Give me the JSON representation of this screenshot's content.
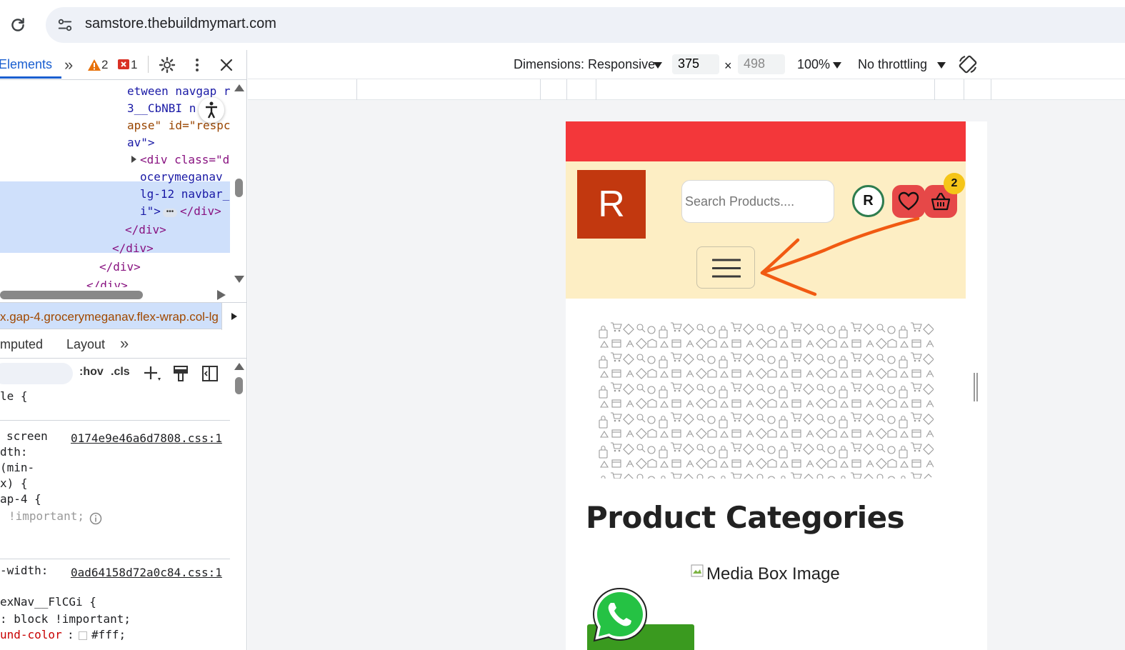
{
  "browser": {
    "url": "samstore.thebuildmymart.com"
  },
  "devtools": {
    "tabs": {
      "elements": "Elements",
      "more": "»"
    },
    "warnings": "2",
    "errors": "1",
    "dom_lines": [
      {
        "text": "etween navgap r",
        "kind": "val"
      },
      {
        "text": "3__CbNBI n  r",
        "kind": "val"
      },
      {
        "text": "apse\" id=\"respc",
        "kind": "mixed"
      },
      {
        "text": "av\">",
        "kind": "val"
      },
      {
        "text": "<div class=\"d",
        "kind": "tag"
      },
      {
        "text": "ocerymeganav",
        "kind": "val"
      },
      {
        "text": "lg-12 navbar_",
        "kind": "val"
      },
      {
        "text": "i\">",
        "kind": "val"
      },
      {
        "text": "</div>",
        "kind": "tag"
      },
      {
        "text": "</div>",
        "kind": "tag"
      },
      {
        "text": "</div>",
        "kind": "tag"
      },
      {
        "text": "</div>",
        "kind": "tag"
      }
    ],
    "dom_selected_close": "</div>",
    "breadcrumb": "x.gap-4.grocerymeganav.flex-wrap.col-lg",
    "subtabs": {
      "computed": "mputed",
      "layout": "Layout"
    },
    "styles_toolbar": {
      "hov": ":hov",
      "cls": ".cls"
    },
    "styles": {
      "rule1_selector": "le {",
      "media_lines": [
        "screen",
        "dth:",
        "(min-",
        "x) {"
      ],
      "media_selector": "ap-4 {",
      "important": "!important;",
      "file1": "0174e9e46a6d7808.css:1",
      "media2": "-width:",
      "file2": "0ad64158d72a0c84.css:1",
      "rule3_selector": "exNav__FlCGi {",
      "rule3_prop1": ": block !important;",
      "rule3_prop2_name": "und-color",
      "rule3_prop2_value": "#fff;"
    }
  },
  "device_toolbar": {
    "dimensions_label": "Dimensions: Responsive",
    "width": "375",
    "height": "498",
    "times": "×",
    "zoom": "100%",
    "throttling": "No throttling"
  },
  "page": {
    "logo_letter": "R",
    "search_placeholder": "Search Products....",
    "avatar_letter": "R",
    "cart_count": "2",
    "section_title": "Product Categories",
    "media_box_alt": "Media Box Image"
  },
  "colors": {
    "topbar": "#f3373a",
    "header_bg": "#fdeec4",
    "logo_bg": "#c2380f",
    "icon_btn": "#e64848",
    "badge": "#f5c518",
    "annotation_arrow": "#f15a12",
    "whatsapp_green": "#3a9a1f"
  }
}
